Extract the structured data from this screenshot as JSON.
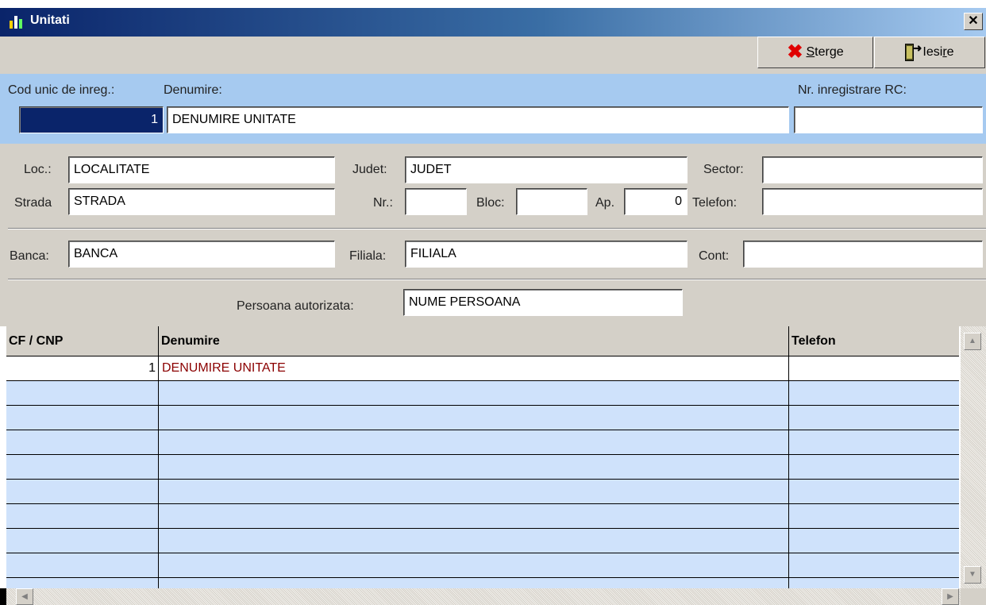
{
  "window": {
    "title": "Unitati",
    "close_label": "✕"
  },
  "toolbar": {
    "sterge_label_first": "S",
    "sterge_label_rest": "terge",
    "iesire_label_pre": "Iesi",
    "iesire_label_ul": "r",
    "iesire_label_post": "e"
  },
  "header": {
    "cod_label": "Cod unic de inreg.:",
    "denumire_label": "Denumire:",
    "rc_label": "Nr. inregistrare RC:",
    "cod_value": "1",
    "denumire_value": "DENUMIRE UNITATE",
    "rc_value": ""
  },
  "address": {
    "loc_label": "Loc.:",
    "loc_value": "LOCALITATE",
    "judet_label": "Judet:",
    "judet_value": "JUDET",
    "sector_label": "Sector:",
    "sector_value": "",
    "strada_label": "Strada",
    "strada_value": "STRADA",
    "nr_label": "Nr.:",
    "nr_value": "",
    "bloc_label": "Bloc:",
    "bloc_value": "",
    "ap_label": "Ap.",
    "ap_value": "0",
    "telefon_label": "Telefon:",
    "telefon_value": ""
  },
  "bank": {
    "banca_label": "Banca:",
    "banca_value": "BANCA",
    "filiala_label": "Filiala:",
    "filiala_value": "FILIALA",
    "cont_label": "Cont:",
    "cont_value": ""
  },
  "authorized": {
    "label": "Persoana autorizata:",
    "value": "NUME PERSOANA"
  },
  "grid": {
    "columns": [
      "CF / CNP",
      "Denumire",
      "Telefon"
    ],
    "rows": [
      {
        "cf": "1",
        "denumire": "DENUMIRE UNITATE",
        "telefon": ""
      }
    ]
  },
  "colors": {
    "header_bg": "#a6caf0",
    "grid_row_bg": "#cfe2fb",
    "title_dark": "#0a246a",
    "panel_bg": "#d4d0c8"
  }
}
